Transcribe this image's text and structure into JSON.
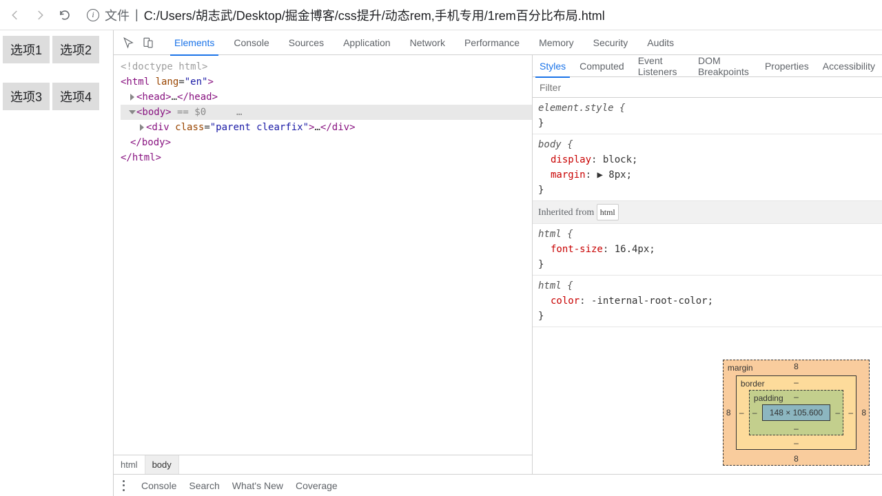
{
  "chrome": {
    "file_label": "文件",
    "url": "C:/Users/胡志武/Desktop/掘金博客/css提升/动态rem,手机专用/1rem百分比布局.html"
  },
  "page": {
    "buttons": [
      "选项1",
      "选项2",
      "选项3",
      "选项4"
    ]
  },
  "devtools": {
    "tabs": [
      "Elements",
      "Console",
      "Sources",
      "Application",
      "Network",
      "Performance",
      "Memory",
      "Security",
      "Audits"
    ],
    "active_tab": "Elements",
    "dom": {
      "doctype": "<!doctype html>",
      "html_open": "<html lang=\"en\">",
      "head": "<head>…</head>",
      "body_open": "<body>",
      "body_sel_suffix": " == $0",
      "div_line": "<div class=\"parent clearfix\">…</div>",
      "body_close": "</body>",
      "html_close": "</html>"
    },
    "crumbs": [
      "html",
      "body"
    ],
    "styles_tabs": [
      "Styles",
      "Computed",
      "Event Listeners",
      "DOM Breakpoints",
      "Properties",
      "Accessibility"
    ],
    "styles_active": "Styles",
    "filter_placeholder": "Filter",
    "rules": {
      "element_style": "element.style {",
      "close": "}",
      "body_sel": "body {",
      "body_props": [
        {
          "name": "display",
          "value": "block;"
        },
        {
          "name": "margin",
          "value": "▶ 8px;"
        }
      ],
      "inherited_label": "Inherited from",
      "inherited_tag": "html",
      "html_sel": "html {",
      "html_props1": [
        {
          "name": "font-size",
          "value": "16.4px;"
        }
      ],
      "html_props2": [
        {
          "name": "color",
          "value": "-internal-root-color;"
        }
      ]
    },
    "boxmodel": {
      "margin_label": "margin",
      "border_label": "border",
      "padding_label": "padding",
      "margin_vals": {
        "top": "8",
        "right": "8",
        "bottom": "8",
        "left": "8"
      },
      "border_vals": {
        "top": "–",
        "right": "–",
        "bottom": "–",
        "left": "–"
      },
      "padding_vals": {
        "top": "–",
        "right": "–",
        "bottom": "–",
        "left": "–"
      },
      "content": "148 × 105.600"
    },
    "drawer": [
      "Console",
      "Search",
      "What's New",
      "Coverage"
    ]
  }
}
